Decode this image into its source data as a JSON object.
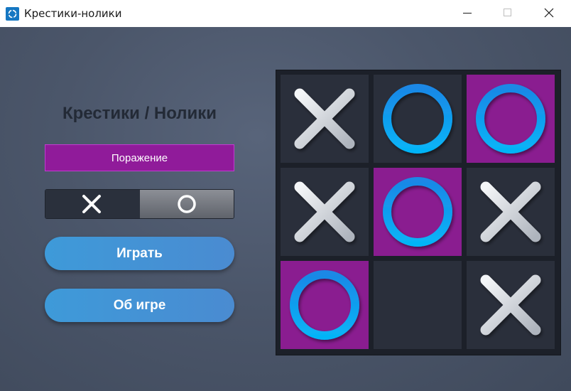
{
  "window": {
    "title": "Крестики-нолики",
    "controls": [
      "minimize",
      "maximize",
      "close"
    ]
  },
  "game": {
    "title": "Крестики / Нолики",
    "status": "Поражение",
    "symbol_toggle": [
      {
        "symbol": "X",
        "icon": "cross-icon",
        "selected": true
      },
      {
        "symbol": "O",
        "icon": "circle-icon",
        "selected": false
      }
    ],
    "play_label": "Играть",
    "about_label": "Об игре"
  },
  "board": {
    "cells": [
      [
        "X",
        "O",
        "O"
      ],
      [
        "X",
        "O",
        "X"
      ],
      [
        "O",
        "",
        "X"
      ]
    ],
    "highlighted": [
      [
        0,
        2
      ],
      [
        1,
        1
      ],
      [
        2,
        0
      ]
    ]
  },
  "colors": {
    "highlight": "#8a1d90",
    "status_bg": "#901b9a",
    "circle": "#0a9df0",
    "cross": "#dfe3e8",
    "cell": "#2a2f3b",
    "button": "#3f98d8"
  }
}
